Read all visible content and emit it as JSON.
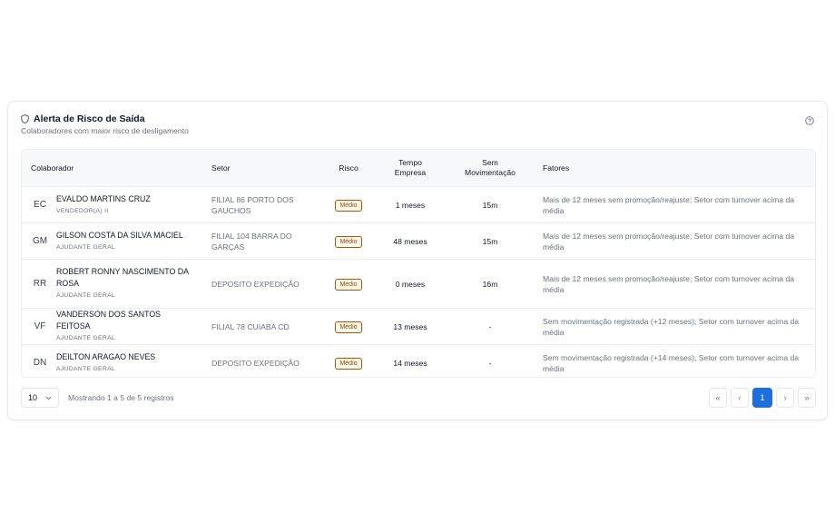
{
  "card": {
    "title": "Alerta de Risco de Saída",
    "subtitle": "Colaboradores com maior risco de desligamento"
  },
  "table": {
    "headers": {
      "colaborador": "Colaborador",
      "setor": "Setor",
      "risco": "Risco",
      "tempo_l1": "Tempo",
      "tempo_l2": "Empresa",
      "sem_l1": "Sem",
      "sem_l2": "Movimentação",
      "fatores": "Fatores"
    },
    "rows": [
      {
        "initials": "EC",
        "name": "EVALDO MARTINS CRUZ",
        "role": "VENDEDOR(A) II",
        "setor": "FILIAL 86 PORTO DOS GAUCHOS",
        "risco": "Médio",
        "tempo": "1 meses",
        "sem_mov": "15m",
        "fatores": "Mais de 12 meses sem promoção/reajuste; Setor com turnover acima da média"
      },
      {
        "initials": "GM",
        "name": "GILSON COSTA DA SILVA MACIEL",
        "role": "AJUDANTE GERAL",
        "setor": "FILIAL 104 BARRA DO GARÇAS",
        "risco": "Médio",
        "tempo": "48 meses",
        "sem_mov": "15m",
        "fatores": "Mais de 12 meses sem promoção/reajuste; Setor com turnover acima da média"
      },
      {
        "initials": "RR",
        "name": "ROBERT RONNY NASCIMENTO DA ROSA",
        "role": "AJUDANTE GERAL",
        "setor": "DEPOSITO EXPEDIÇÃO",
        "risco": "Médio",
        "tempo": "0 meses",
        "sem_mov": "16m",
        "fatores": "Mais de 12 meses sem promoção/reajuste; Setor com turnover acima da média"
      },
      {
        "initials": "VF",
        "name": "VANDERSON DOS SANTOS FEITOSA",
        "role": "AJUDANTE GERAL",
        "setor": "FILIAL 78 CUIABA CD",
        "risco": "Médio",
        "tempo": "13 meses",
        "sem_mov": "-",
        "fatores": "Sem movimentação registrada (+12 meses); Setor com turnover acima da média"
      },
      {
        "initials": "DN",
        "name": "DEILTON ARAGAO NEVES",
        "role": "AJUDANTE GERAL",
        "setor": "DEPOSITO EXPEDIÇÃO",
        "risco": "Médio",
        "tempo": "14 meses",
        "sem_mov": "-",
        "fatores": "Sem movimentação registrada (+14 meses); Setor com turnover acima da média"
      }
    ]
  },
  "footer": {
    "page_size": "10",
    "info": "Mostrando 1 a 5 de 5 registros",
    "pager": {
      "first": "«",
      "prev": "‹",
      "current": "1",
      "next": "›",
      "last": "»"
    }
  },
  "colors": {
    "accent": "#1d6fe0",
    "badge_border": "#b45309",
    "badge_text": "#92400e"
  },
  "icons": {
    "title": "shield-icon",
    "help": "help-circle-icon",
    "dropdown": "chevron-down-icon"
  }
}
